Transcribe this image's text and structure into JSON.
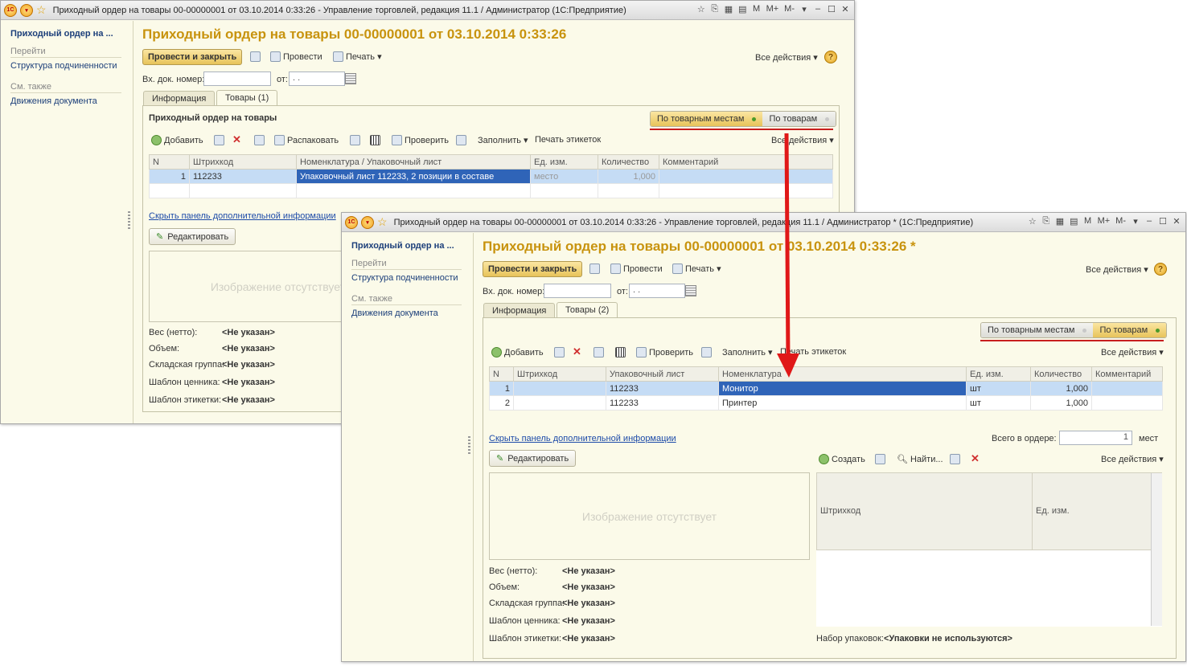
{
  "window1": {
    "title": "Приходный ордер на товары 00-00000001 от 03.10.2014 0:33:26 - Управление торговлей, редакция 11.1 / Администратор  (1С:Предприятие)",
    "sidebar": {
      "current": "Приходный ордер на ...",
      "goto_header": "Перейти",
      "goto_link": "Структура подчиненности",
      "seealso_header": "См. также",
      "seealso_link": "Движения документа"
    },
    "doc_title": "Приходный ордер на товары 00-00000001 от 03.10.2014 0:33:26",
    "toolbar": {
      "post_close": "Провести и закрыть",
      "post": "Провести",
      "print": "Печать ▾",
      "all_actions": "Все действия ▾"
    },
    "incoming": {
      "label": "Вх. док. номер:",
      "value": "",
      "from_label": "от:",
      "date": " .  ."
    },
    "tabs": [
      "Информация",
      "Товары (1)"
    ],
    "section_title": "Приходный ордер на товары",
    "mode": {
      "by_places": "По товарным местам",
      "by_goods": "По товарам"
    },
    "grid_toolbar": {
      "add": "Добавить",
      "unpack": "Распаковать",
      "check": "Проверить",
      "fill": "Заполнить ▾",
      "print_labels": "Печать этикеток",
      "all_actions": "Все действия ▾"
    },
    "columns": [
      "N",
      "Штрихкод",
      "Номенклатура / Упаковочный лист",
      "Ед. изм.",
      "Количество",
      "Комментарий"
    ],
    "rows": [
      {
        "n": "1",
        "barcode": "112233",
        "item": "Упаковочный лист 112233, 2 позиции в составе",
        "unit": "место",
        "qty": "1,000",
        "comment": ""
      }
    ],
    "hide_panel": "Скрыть панель дополнительной информации",
    "edit": "Редактировать",
    "no_image": "Изображение отсутствует",
    "props": [
      {
        "label": "Вес (нетто):",
        "value": "<Не указан>"
      },
      {
        "label": "Объем:",
        "value": "<Не указан>"
      },
      {
        "label": "Складская группа:",
        "value": "<Не указан>"
      },
      {
        "label": "Шаблон ценника:",
        "value": "<Не указан>"
      },
      {
        "label": "Шаблон этикетки:",
        "value": "<Не указан>"
      }
    ]
  },
  "window2": {
    "title": "Приходный ордер на товары 00-00000001 от 03.10.2014 0:33:26 - Управление торговлей, редакция 11.1 / Администратор *  (1С:Предприятие)",
    "sidebar": {
      "current": "Приходный ордер на ...",
      "goto_header": "Перейти",
      "goto_link": "Структура подчиненности",
      "seealso_header": "См. также",
      "seealso_link": "Движения документа"
    },
    "doc_title": "Приходный ордер на товары 00-00000001 от 03.10.2014 0:33:26 *",
    "toolbar": {
      "post_close": "Провести и закрыть",
      "post": "Провести",
      "print": "Печать ▾",
      "all_actions": "Все действия ▾"
    },
    "incoming": {
      "label": "Вх. док. номер:",
      "value": "",
      "from_label": "от:",
      "date": " .  ."
    },
    "tabs": [
      "Информация",
      "Товары (2)"
    ],
    "mode": {
      "by_places": "По товарным местам",
      "by_goods": "По товарам"
    },
    "grid_toolbar": {
      "add": "Добавить",
      "check": "Проверить",
      "fill": "Заполнить ▾",
      "print_labels": "Печать этикеток",
      "all_actions": "Все действия ▾"
    },
    "columns": [
      "N",
      "Штрихкод",
      "Упаковочный лист",
      "Номенклатура",
      "Ед. изм.",
      "Количество",
      "Комментарий"
    ],
    "rows": [
      {
        "n": "1",
        "barcode": "",
        "packlist": "112233",
        "item": "Монитор",
        "unit": "шт",
        "qty": "1,000",
        "comment": ""
      },
      {
        "n": "2",
        "barcode": "",
        "packlist": "112233",
        "item": "Принтер",
        "unit": "шт",
        "qty": "1,000",
        "comment": ""
      }
    ],
    "hide_panel": "Скрыть панель дополнительной информации",
    "total_label": "Всего в ордере:",
    "total_value": "1",
    "total_unit": "мест",
    "edit": "Редактировать",
    "right_toolbar": {
      "create": "Создать",
      "find": "Найти...",
      "all_actions": "Все действия ▾"
    },
    "right_columns": [
      "Штрихкод",
      "Ед. изм."
    ],
    "no_image": "Изображение отсутствует",
    "props": [
      {
        "label": "Вес (нетто):",
        "value": "<Не указан>"
      },
      {
        "label": "Объем:",
        "value": "<Не указан>"
      },
      {
        "label": "Складская группа:",
        "value": "<Не указан>"
      },
      {
        "label": "Шаблон ценника:",
        "value": "<Не указан>"
      },
      {
        "label": "Шаблон этикетки:",
        "value": "<Не указан>"
      }
    ],
    "packaging_label": "Набор упаковок:",
    "packaging_value": "<Упаковки не используются>"
  },
  "titlebar_buttons": [
    "M",
    "M+",
    "M-",
    "▾",
    "–",
    "☐",
    "✕"
  ],
  "colors": {
    "accent_title": "#c8930e",
    "link": "#1c3f7a",
    "highlight_red": "#c81e1e",
    "selection": "#c5dcf5"
  }
}
